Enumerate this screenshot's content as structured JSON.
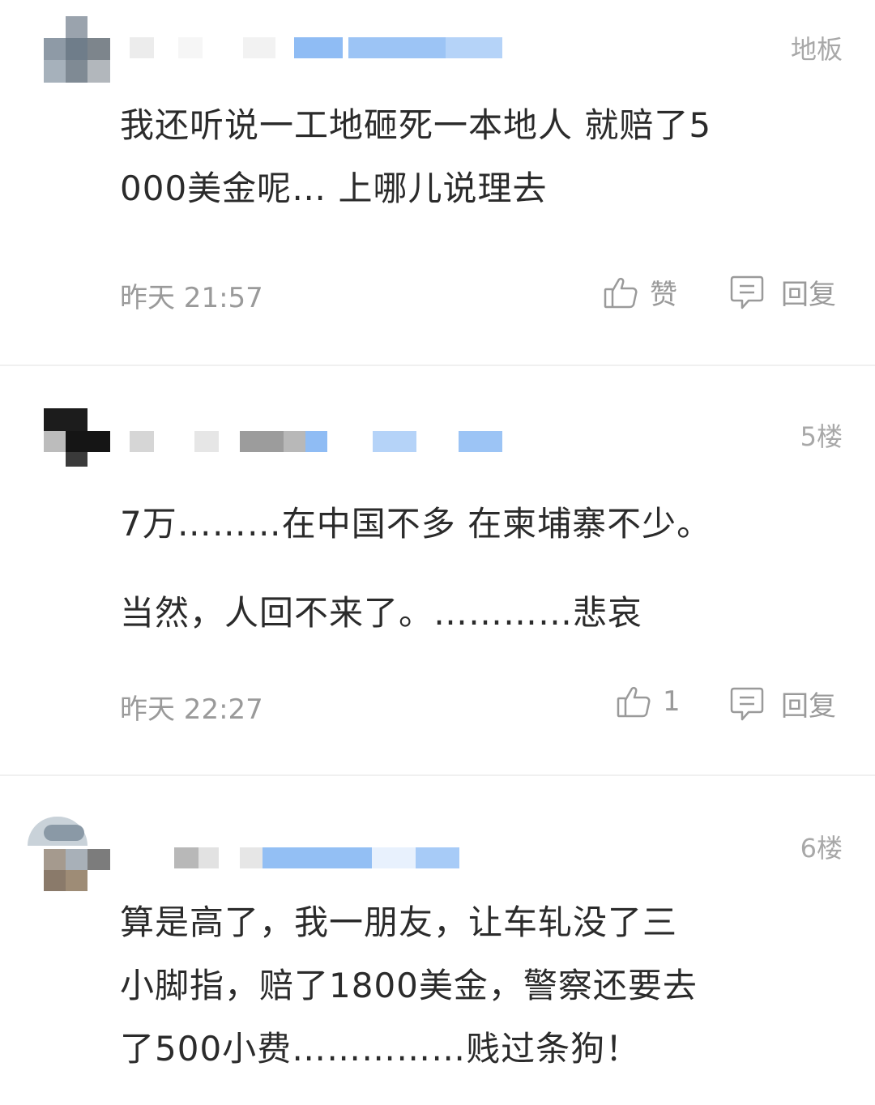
{
  "comments": [
    {
      "floor": "地板",
      "content": [
        "我还听说一工地砸死一本地人 就赔了5",
        "000美金呢… 上哪儿说理去"
      ],
      "time": "昨天 21:57",
      "like_label": "赞",
      "reply_label": "回复"
    },
    {
      "floor": "5楼",
      "content": [
        "7万………在中国不多 在柬埔寨不少。",
        "当然，人回不来了。…………悲哀"
      ],
      "time": "昨天 22:27",
      "like_label": "1",
      "reply_label": "回复"
    },
    {
      "floor": "6楼",
      "content": [
        "算是高了，我一朋友，让车轧没了三",
        "小脚指，赔了1800美金，警察还要去",
        "了500小费……………贱过条狗！"
      ]
    }
  ],
  "icons": {
    "like": "thumbs-up-icon",
    "reply": "comment-bubble-icon"
  },
  "colors": {
    "text": "#2b2b2b",
    "meta": "#9a9a9a",
    "blur_blue": "#8fbcf4"
  }
}
